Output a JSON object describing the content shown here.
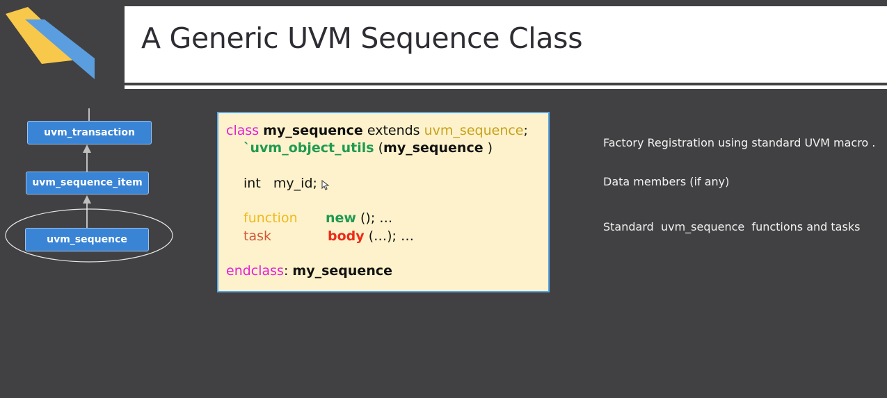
{
  "slide": {
    "title": "A Generic UVM Sequence Class"
  },
  "hierarchy": {
    "items": [
      {
        "label": "uvm_transaction"
      },
      {
        "label": "uvm_sequence_item"
      },
      {
        "label": "uvm_sequence"
      }
    ],
    "highlighted": "uvm_sequence"
  },
  "code": {
    "line1": {
      "kw_class": "class",
      "name": "my_sequence",
      "extends": "extends",
      "base": "uvm_sequence",
      "semi": ";"
    },
    "line2": {
      "macro": "`uvm_object_utils",
      "arg_open": "(",
      "arg": "my_sequence",
      "arg_close": " )"
    },
    "line3": {
      "type": "int",
      "var": "my_id;"
    },
    "line4": {
      "kw": "function",
      "name": "new",
      "rest": "(); …"
    },
    "line5": {
      "kw": "task",
      "name": "body",
      "rest": "(…); …"
    },
    "line6": {
      "kw": "endclass",
      "rest": ": ",
      "name": "my_sequence"
    }
  },
  "notes": [
    {
      "text": "Factory Registration using standard UVM macro ."
    },
    {
      "text": "Data members (if any)"
    },
    {
      "text": "Standard  uvm_sequence  functions and tasks"
    }
  ],
  "colors": {
    "background": "#414143",
    "code_bg": "#fdf2cb",
    "box_blue": "#3a84d6",
    "logo_yellow": "#f8c84a",
    "logo_blue": "#5b9ee0"
  }
}
